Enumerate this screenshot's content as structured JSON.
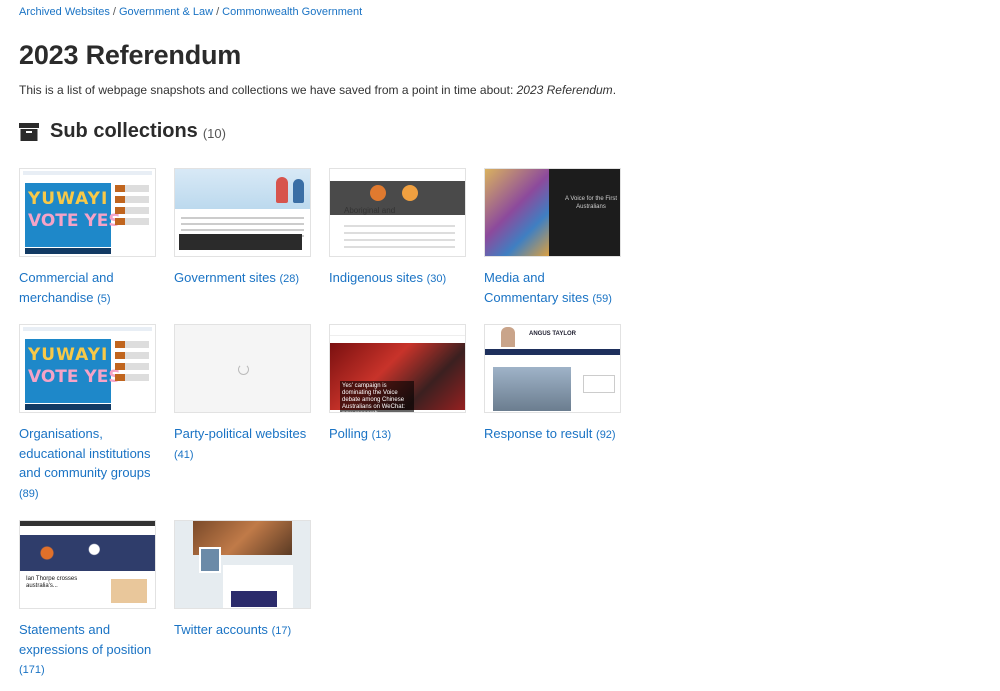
{
  "breadcrumb": [
    "Archived Websites",
    "Government & Law",
    "Commonwealth Government"
  ],
  "breadcrumb_sep": "/",
  "page_title": "2023 Referendum",
  "intro": {
    "prefix": "This is a list of webpage snapshots and collections we have saved from a point in time about: ",
    "subject": "2023 Referendum",
    "suffix": "."
  },
  "subcollections": {
    "heading": "Sub collections",
    "count": "(10)",
    "icon": "archive-box-icon"
  },
  "cards": [
    {
      "label": "Commercial and merchandise",
      "count": "(5)",
      "thumb": "yes"
    },
    {
      "label": "Government sites",
      "count": "(28)",
      "thumb": "gov"
    },
    {
      "label": "Indigenous sites",
      "count": "(30)",
      "thumb": "ind"
    },
    {
      "label": "Media and Commentary sites",
      "count": "(59)",
      "thumb": "media"
    },
    {
      "label": "Organisations, educational institutions and community groups",
      "count": "(89)",
      "thumb": "yes"
    },
    {
      "label": "Party-political websites",
      "count": "(41)",
      "thumb": "blank"
    },
    {
      "label": "Polling",
      "count": "(13)",
      "thumb": "poll"
    },
    {
      "label": "Response to result",
      "count": "(92)",
      "thumb": "resp"
    },
    {
      "label": "Statements and expressions of position",
      "count": "(171)",
      "thumb": "stmt"
    },
    {
      "label": "Twitter accounts",
      "count": "(17)",
      "thumb": "tw"
    }
  ],
  "thumb_text": {
    "yes_word1": "YUWAYI",
    "yes_word2": "VOTE YES",
    "ind_title": "Aboriginal and",
    "media_text": "A Voice for the First Australians",
    "poll_caption": "Yes' campaign is dominating the Voice debate among Chinese Australians on WeChat: new research",
    "resp_name": "ANGUS TAYLOR",
    "stmt_head": "Ian Thorpe crosses australia's..."
  },
  "colors": {
    "link": "#1a73c4",
    "text": "#333333",
    "heading": "#2b2b2b"
  }
}
